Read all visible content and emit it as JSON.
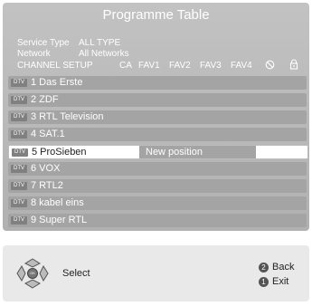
{
  "title": "Programme Table",
  "service_type": {
    "label": "Service Type",
    "value": "ALL TYPE"
  },
  "network": {
    "label": "Network",
    "value": "All Networks"
  },
  "channel_setup": {
    "label": "CHANNEL SETUP",
    "columns": [
      "CA",
      "FAV1",
      "FAV2",
      "FAV3",
      "FAV4"
    ],
    "icons": [
      "skip-icon",
      "lock-icon"
    ]
  },
  "channels": [
    {
      "badge": "DTV",
      "label": "1 Das Erste"
    },
    {
      "badge": "DTV",
      "label": "2 ZDF"
    },
    {
      "badge": "DTV",
      "label": "3 RTL Television"
    },
    {
      "badge": "DTV",
      "label": "4 SAT.1"
    },
    {
      "badge": "DTV",
      "label": "5 ProSieben",
      "selected": true,
      "hint": "New position"
    },
    {
      "badge": "DTV",
      "label": "6 VOX"
    },
    {
      "badge": "DTV",
      "label": "7 RTL2"
    },
    {
      "badge": "DTV",
      "label": "8 kabel eins"
    },
    {
      "badge": "DTV",
      "label": "9 Super RTL"
    }
  ],
  "footer": {
    "select_label": "Select",
    "back_key": "2",
    "back_label": "Back",
    "exit_key": "1",
    "exit_label": "Exit",
    "ok_key": "OK"
  },
  "colors": {
    "panel": "#b8b8b8",
    "row": "#a4a4a4",
    "selected_row": "#ffffff",
    "badge": "#808080",
    "footer": "#e9e9e9"
  }
}
